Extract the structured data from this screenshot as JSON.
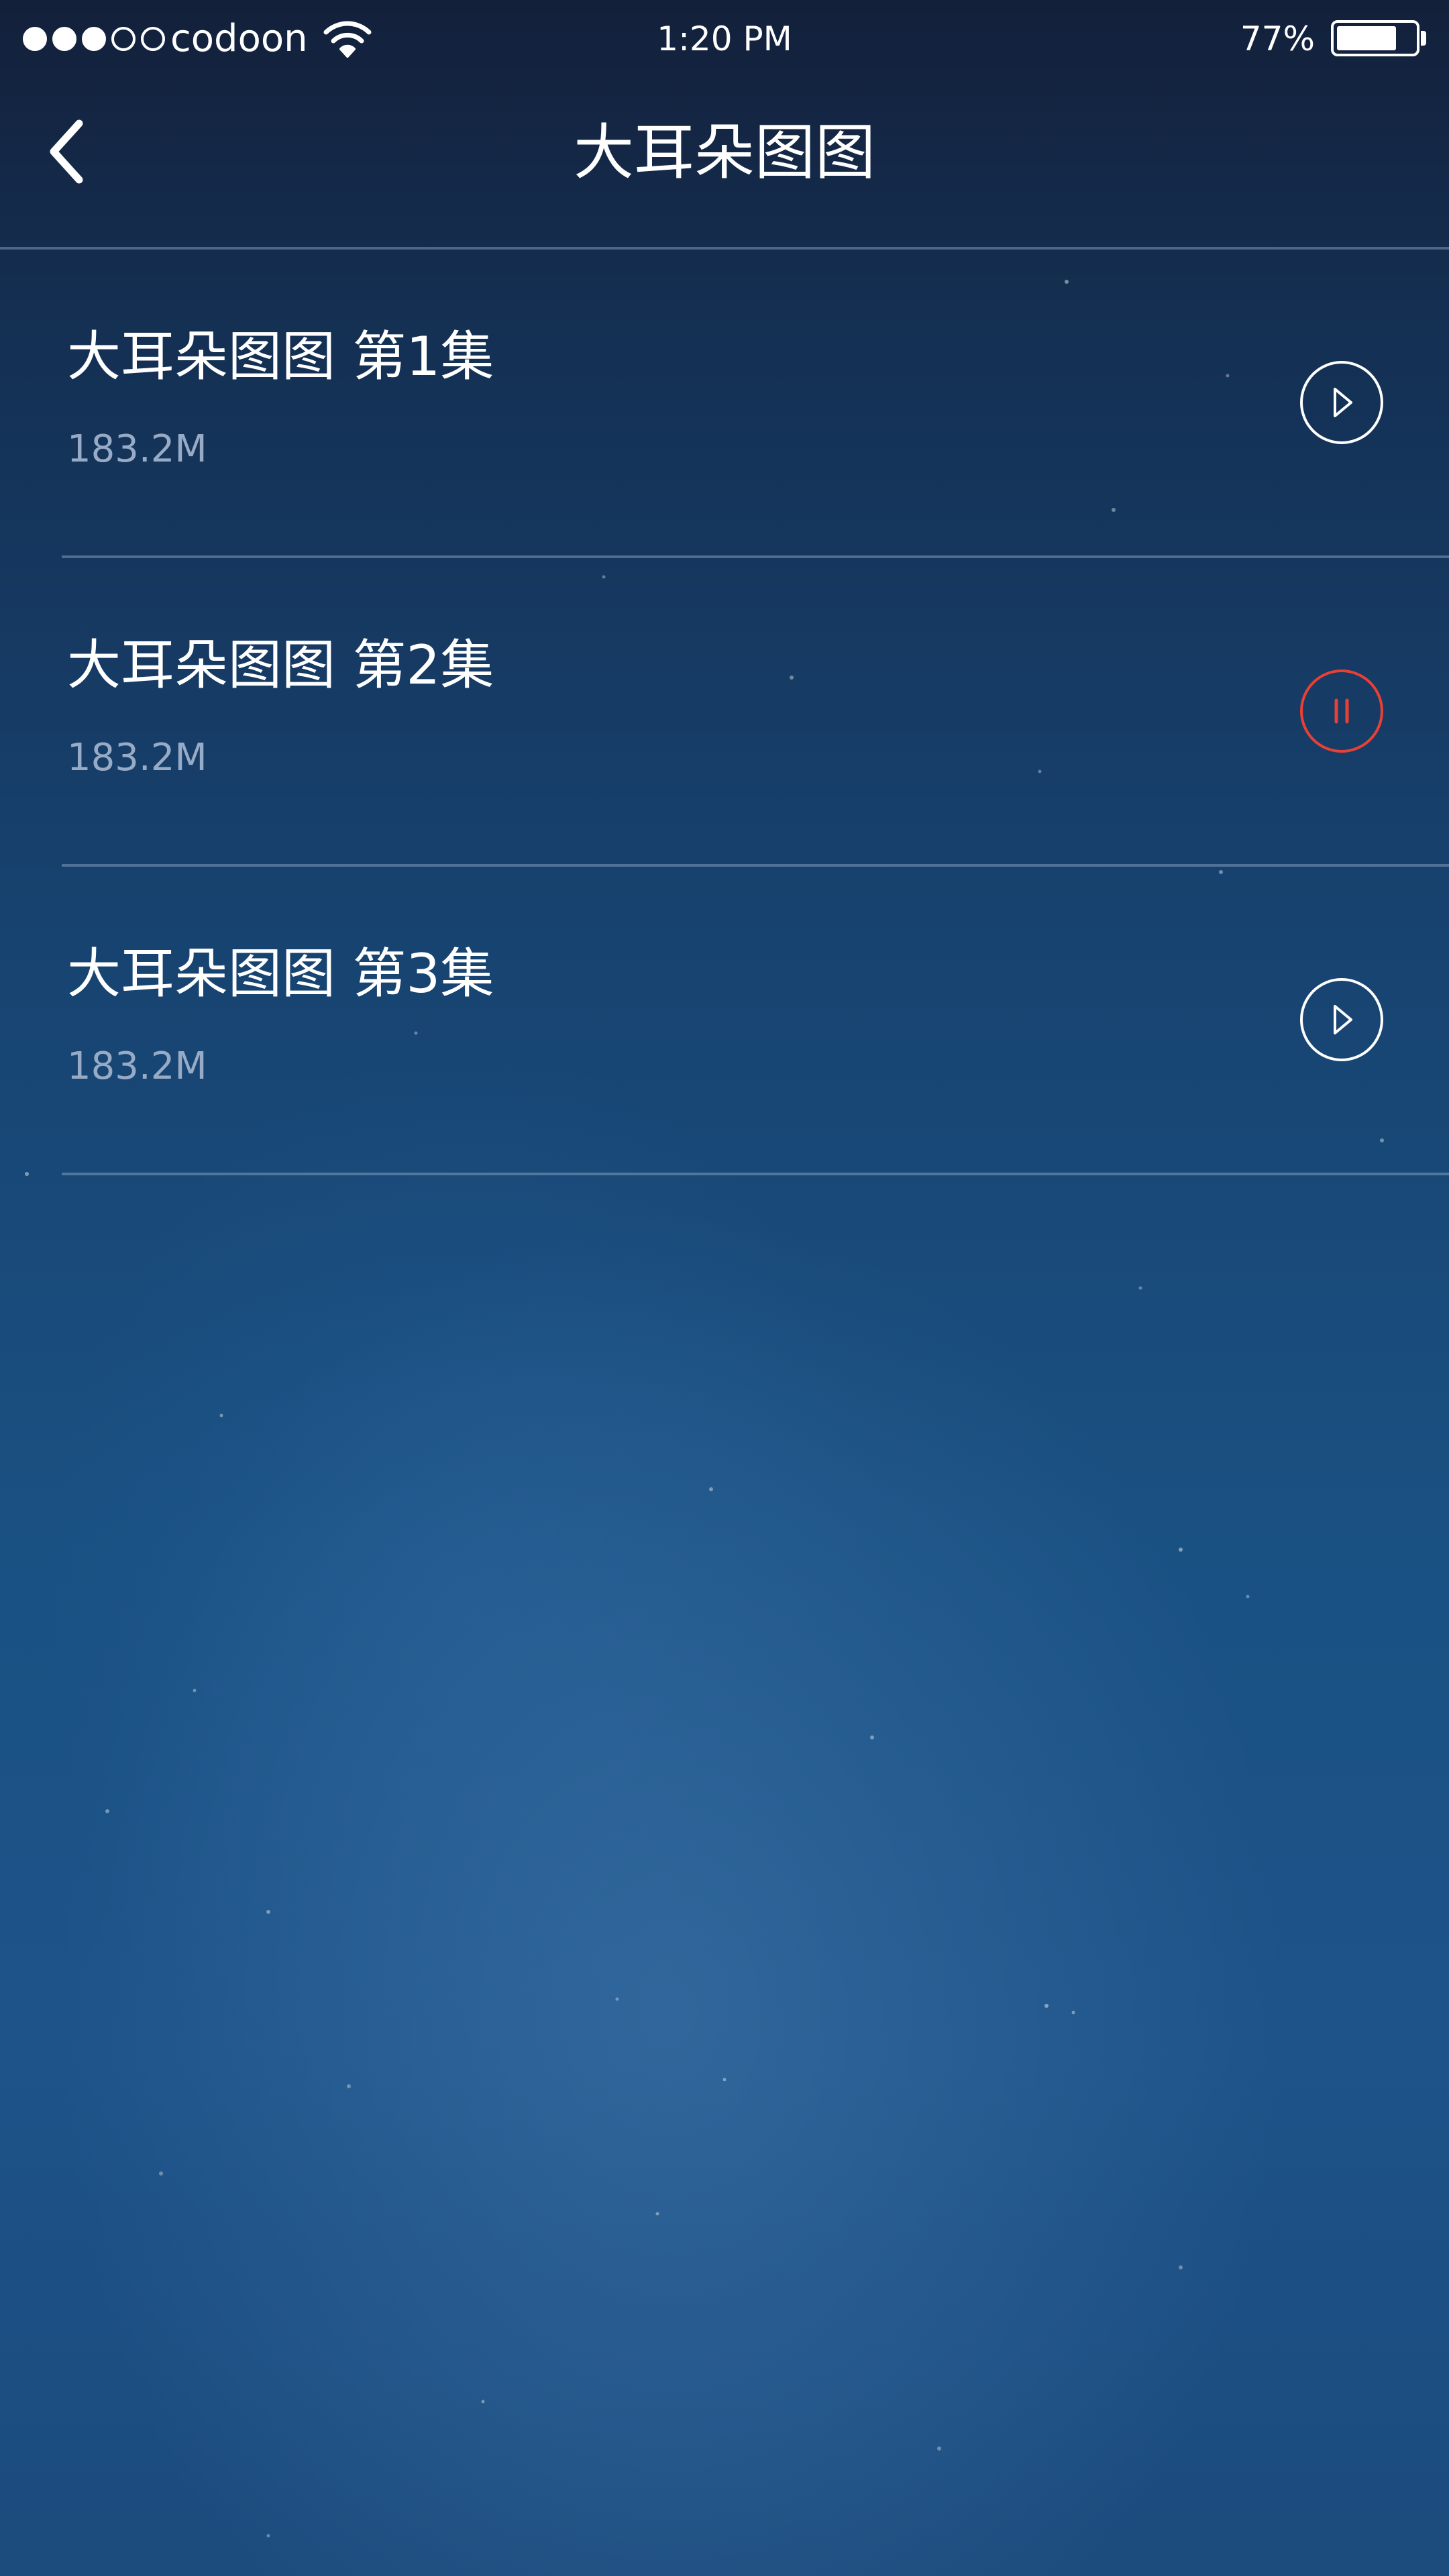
{
  "status_bar": {
    "carrier": "codoon",
    "time": "1:20 PM",
    "battery_percent": "77%",
    "battery_level": 0.77,
    "signal_strength": 3,
    "signal_max": 5
  },
  "nav": {
    "title": "大耳朵图图",
    "back_icon": "chevron-left-icon"
  },
  "episodes": [
    {
      "title": "大耳朵图图 第1集",
      "size": "183.2M",
      "state": "play",
      "icon": "play-icon"
    },
    {
      "title": "大耳朵图图 第2集",
      "size": "183.2M",
      "state": "pause",
      "icon": "pause-icon"
    },
    {
      "title": "大耳朵图图 第3集",
      "size": "183.2M",
      "state": "play",
      "icon": "play-icon"
    }
  ],
  "colors": {
    "accent_pause": "#e84036",
    "text_primary": "#ffffff",
    "text_secondary": "#97abc6",
    "divider": "#96afcd"
  }
}
